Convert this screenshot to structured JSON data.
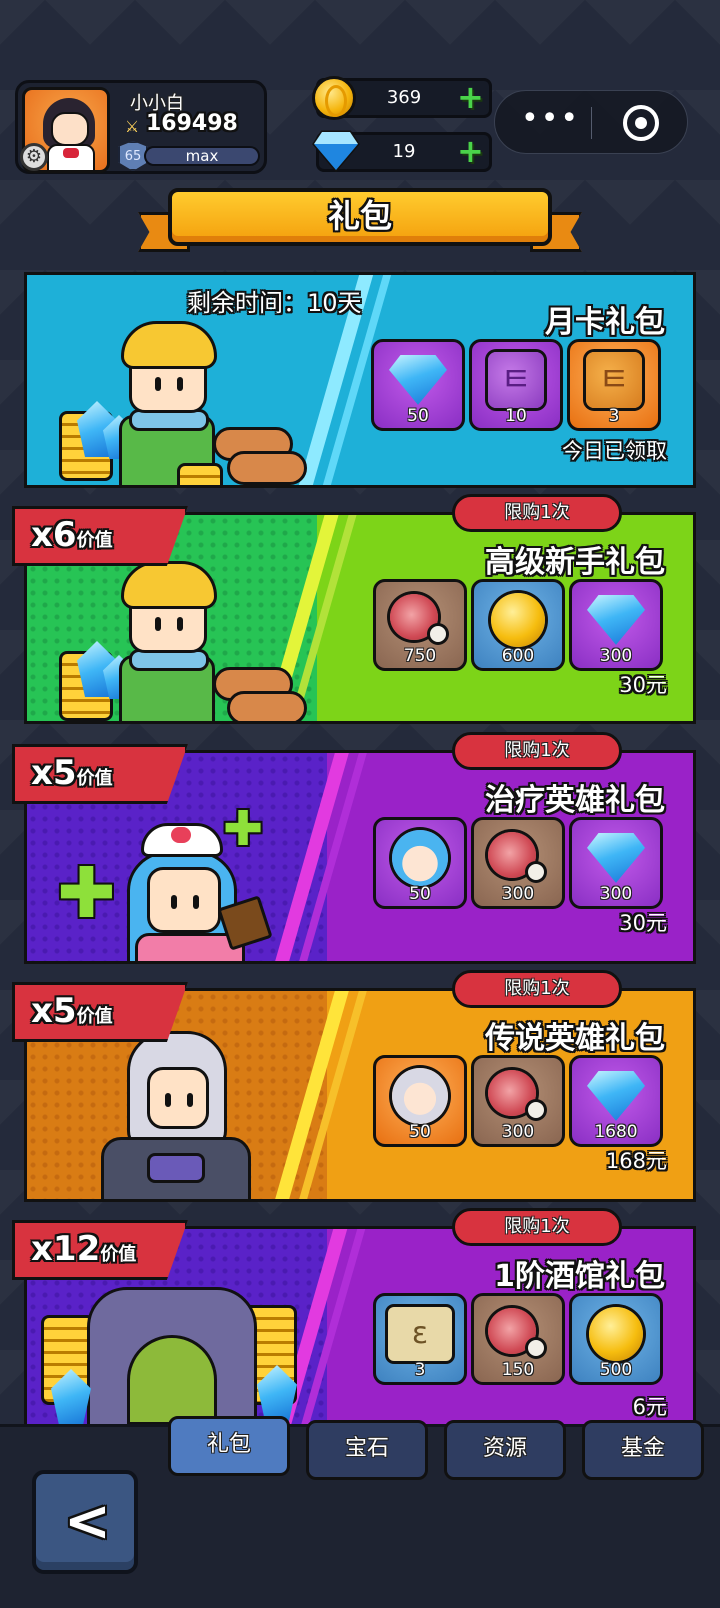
{
  "player": {
    "name": "小小白",
    "power": "169498",
    "level": "65",
    "level_status": "max"
  },
  "currency": {
    "gold": "369",
    "diamonds": "19"
  },
  "title": "礼包",
  "monthly_card": {
    "remaining_time": "剩余时间：10天",
    "name": "月卡礼包",
    "items": [
      {
        "icon": "diamond-icon",
        "qty": "50"
      },
      {
        "icon": "purple-scroll-icon",
        "qty": "10"
      },
      {
        "icon": "orange-scroll-icon",
        "qty": "3"
      }
    ],
    "status": "今日已领取"
  },
  "packs": [
    {
      "value_tag": "x6",
      "value_suffix": "价值",
      "limit": "限购1次",
      "name": "高级新手礼包",
      "items": [
        {
          "icon": "meat-icon",
          "qty": "750"
        },
        {
          "icon": "gold-coin-icon",
          "qty": "600"
        },
        {
          "icon": "diamond-icon",
          "qty": "300"
        }
      ],
      "price": "30元"
    },
    {
      "value_tag": "x5",
      "value_suffix": "价值",
      "limit": "限购1次",
      "name": "治疗英雄礼包",
      "items": [
        {
          "icon": "nurse-hero-shard-icon",
          "qty": "50"
        },
        {
          "icon": "meat-icon",
          "qty": "300"
        },
        {
          "icon": "diamond-icon",
          "qty": "300"
        }
      ],
      "price": "30元"
    },
    {
      "value_tag": "x5",
      "value_suffix": "价值",
      "limit": "限购1次",
      "name": "传说英雄礼包",
      "items": [
        {
          "icon": "knight-hero-shard-icon",
          "qty": "50"
        },
        {
          "icon": "meat-icon",
          "qty": "300"
        },
        {
          "icon": "diamond-icon",
          "qty": "1680"
        }
      ],
      "price": "168元"
    },
    {
      "value_tag": "x12",
      "value_suffix": "价值",
      "limit": "限购1次",
      "name": "1阶酒馆礼包",
      "items": [
        {
          "icon": "tavern-ticket-icon",
          "qty": "3"
        },
        {
          "icon": "meat-icon",
          "qty": "150"
        },
        {
          "icon": "gold-coin-icon",
          "qty": "500"
        }
      ],
      "price": "6元"
    }
  ],
  "tabs": [
    "礼包",
    "宝石",
    "资源",
    "基金"
  ],
  "active_tab": "礼包",
  "colors": {
    "monthly_bg": "#1eb0d8",
    "newbie_bg": "#7dd418",
    "healer_bg": "#9a22c8",
    "legend_bg": "#f0a014",
    "tavern_bg": "#9a22c8",
    "tag_red": "#d8333f",
    "ribbon_orange": "#f4a00d"
  }
}
